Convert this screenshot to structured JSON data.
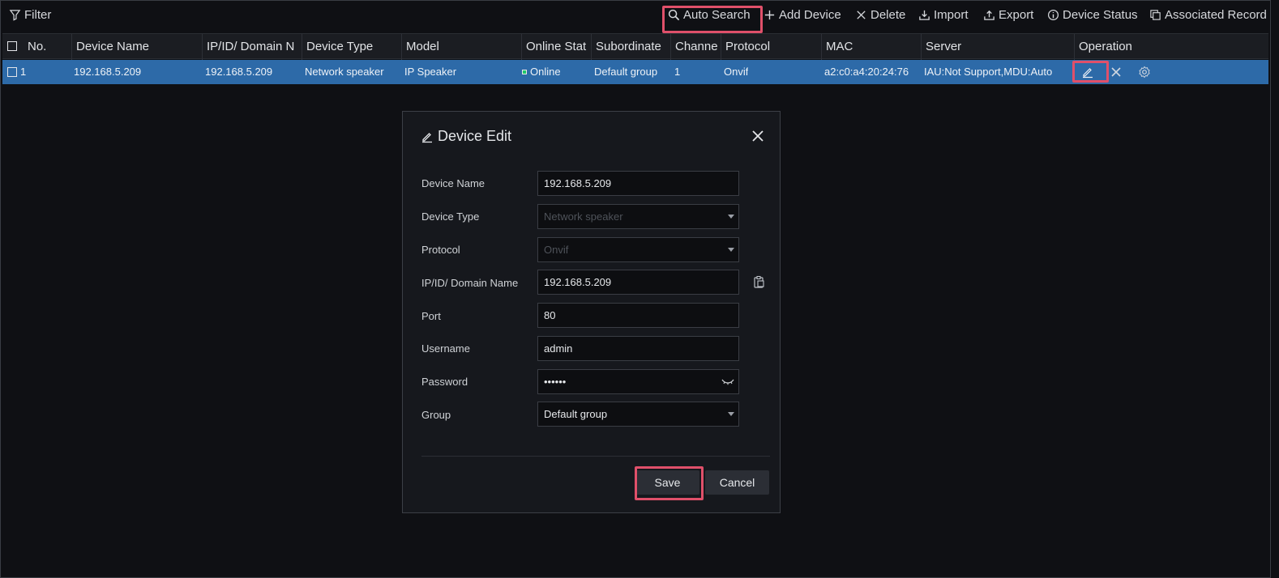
{
  "toolbar": {
    "filter": "Filter",
    "auto_search": "Auto Search",
    "add_device": "Add Device",
    "delete": "Delete",
    "import": "Import",
    "export": "Export",
    "device_status": "Device Status",
    "associated_record": "Associated Record"
  },
  "table": {
    "columns": [
      "No.",
      "Device Name",
      "IP/ID/ Domain N",
      "Device Type",
      "Model",
      "Online Stat",
      "Subordinate",
      "Channe",
      "Protocol",
      "MAC",
      "Server",
      "Operation"
    ],
    "rows": [
      {
        "no": "1",
        "device_name": "192.168.5.209",
        "ip": "192.168.5.209",
        "device_type": "Network speaker",
        "model": "IP Speaker",
        "online": "Online",
        "subordinate": "Default group",
        "channel": "1",
        "protocol": "Onvif",
        "mac": "a2:c0:a4:20:24:76",
        "server": "IAU:Not Support,MDU:Auto"
      }
    ]
  },
  "dialog": {
    "title": "Device Edit",
    "labels": {
      "device_name": "Device Name",
      "device_type": "Device Type",
      "protocol": "Protocol",
      "ip": "IP/ID/ Domain Name",
      "port": "Port",
      "username": "Username",
      "password": "Password",
      "group": "Group"
    },
    "values": {
      "device_name": "192.168.5.209",
      "device_type": "Network speaker",
      "protocol": "Onvif",
      "ip": "192.168.5.209",
      "port": "80",
      "username": "admin",
      "password": "••••••",
      "group": "Default group"
    },
    "save": "Save",
    "cancel": "Cancel"
  },
  "colors": {
    "selected_row": "#2d6aa8",
    "highlight": "#e0506a",
    "online": "#1ec86a"
  }
}
